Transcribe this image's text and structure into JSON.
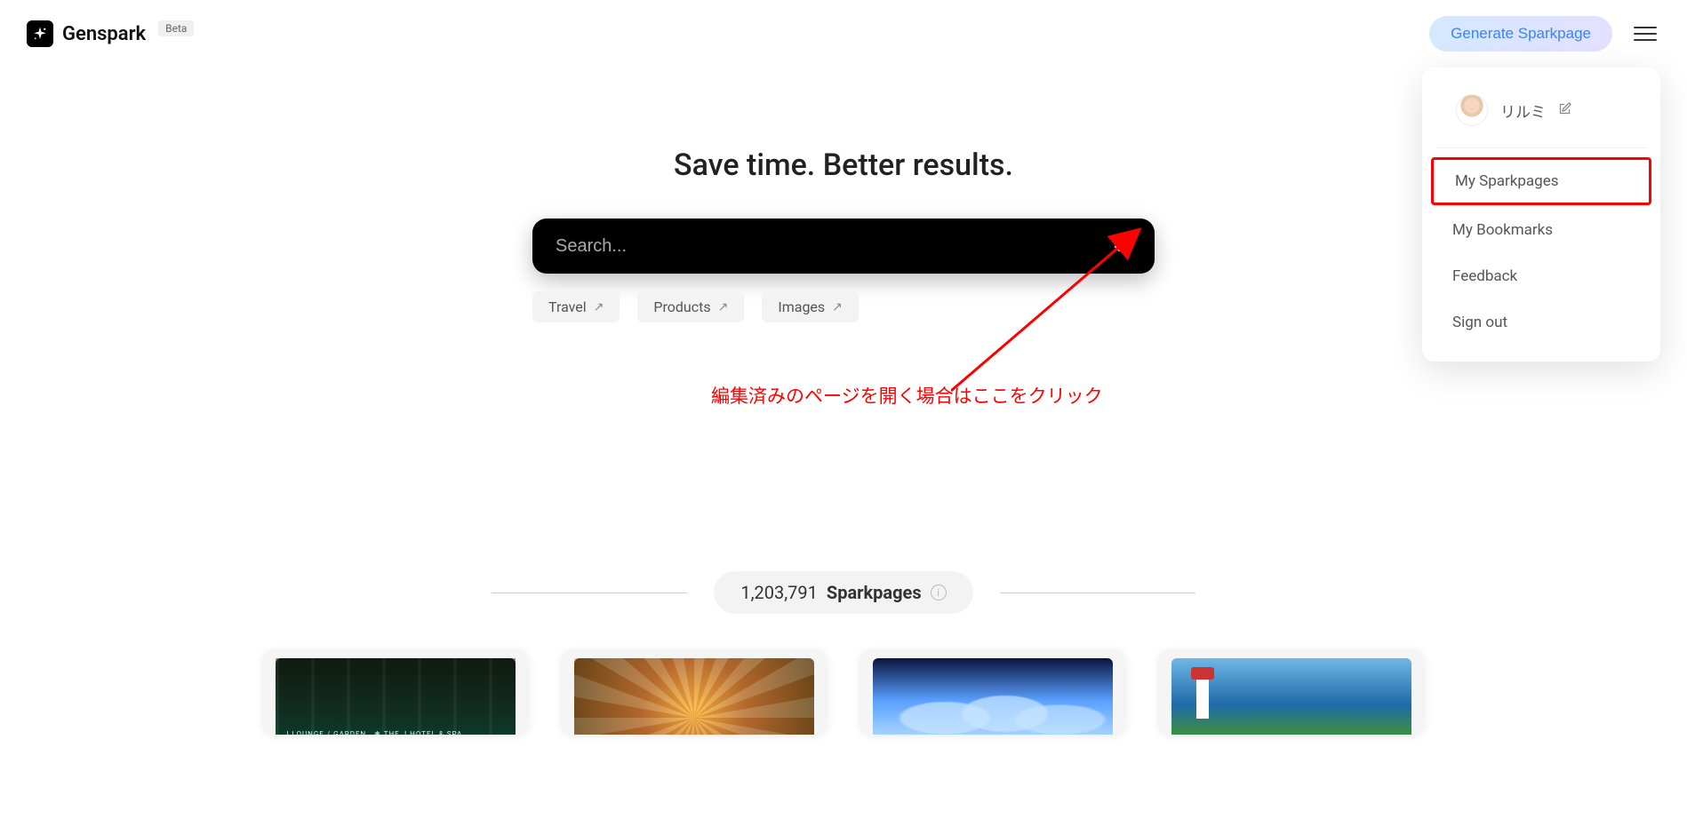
{
  "header": {
    "logo_text": "Genspark",
    "beta_label": "Beta",
    "generate_label": "Generate Sparkpage"
  },
  "hero": {
    "title": "Save time. Better results."
  },
  "search": {
    "placeholder": "Search..."
  },
  "tags": [
    {
      "label": "Travel"
    },
    {
      "label": "Products"
    },
    {
      "label": "Images"
    }
  ],
  "sparkpages": {
    "count": "1,203,791",
    "label": "Sparkpages"
  },
  "dropdown": {
    "username": "リルミ",
    "items": [
      {
        "label": "My Sparkpages",
        "highlight": true
      },
      {
        "label": "My Bookmarks"
      },
      {
        "label": "Feedback"
      },
      {
        "label": "Sign out"
      }
    ]
  },
  "annotation": {
    "text": "編集済みのページを開く場合はここをクリック"
  }
}
